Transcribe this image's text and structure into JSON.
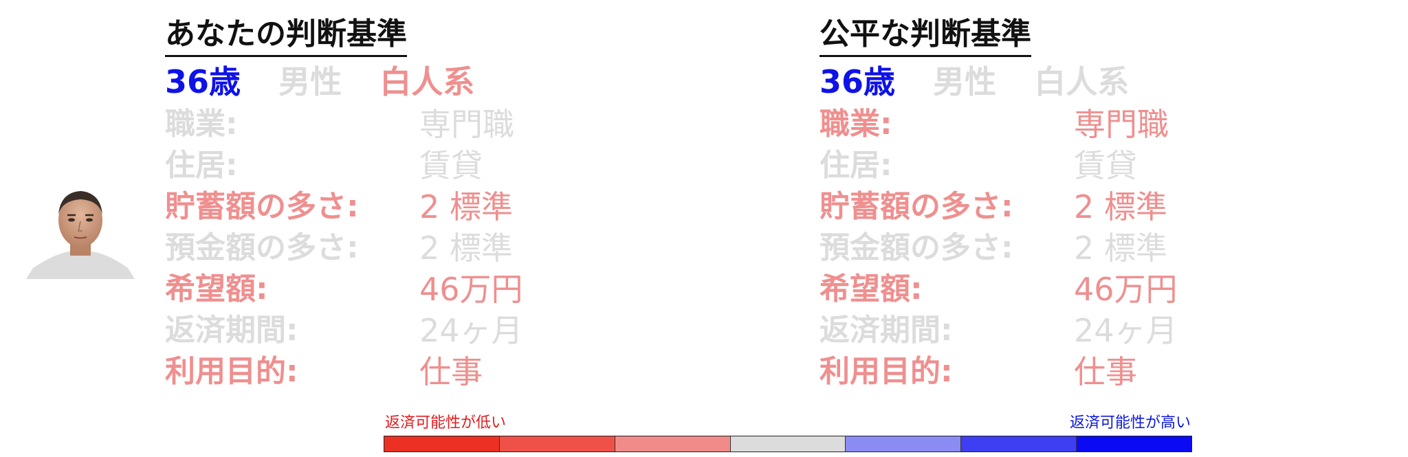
{
  "colors": {
    "age": "#0f12e6",
    "highlight": "#ef8f8f",
    "muted": "#dcdcdc",
    "scale_low_text": "#e31a1c",
    "scale_high_text": "#0b17d8"
  },
  "left_panel": {
    "title": "あなたの判断基準",
    "attributes": [
      {
        "text": "36歳",
        "color": "#0f12e6"
      },
      {
        "text": "男性",
        "color": "#dcdcdc"
      },
      {
        "text": "白人系",
        "color": "#ef8f8f"
      }
    ],
    "fields": [
      {
        "label": "職業:",
        "value": "専門職",
        "color": "#dcdcdc"
      },
      {
        "label": "住居:",
        "value": "賃貸",
        "color": "#dcdcdc"
      },
      {
        "label": "貯蓄額の多さ:",
        "value": "2 標準",
        "color": "#ef8f8f"
      },
      {
        "label": "預金額の多さ:",
        "value": "2 標準",
        "color": "#dcdcdc"
      },
      {
        "label": "希望額:",
        "value": "46万円",
        "color": "#ef8f8f"
      },
      {
        "label": "返済期間:",
        "value": "24ヶ月",
        "color": "#dcdcdc"
      },
      {
        "label": "利用目的:",
        "value": "仕事",
        "color": "#ef8f8f"
      }
    ]
  },
  "right_panel": {
    "title": "公平な判断基準",
    "attributes": [
      {
        "text": "36歳",
        "color": "#0f12e6"
      },
      {
        "text": "男性",
        "color": "#dcdcdc"
      },
      {
        "text": "白人系",
        "color": "#dcdcdc"
      }
    ],
    "fields": [
      {
        "label": "職業:",
        "value": "専門職",
        "color": "#ef8f8f"
      },
      {
        "label": "住居:",
        "value": "賃貸",
        "color": "#dcdcdc"
      },
      {
        "label": "貯蓄額の多さ:",
        "value": "2 標準",
        "color": "#ef8f8f"
      },
      {
        "label": "預金額の多さ:",
        "value": "2 標準",
        "color": "#dcdcdc"
      },
      {
        "label": "希望額:",
        "value": "46万円",
        "color": "#ef8f8f"
      },
      {
        "label": "返済期間:",
        "value": "24ヶ月",
        "color": "#dcdcdc"
      },
      {
        "label": "利用目的:",
        "value": "仕事",
        "color": "#ef8f8f"
      }
    ]
  },
  "scale": {
    "low_label": "返済可能性が低い",
    "high_label": "返済可能性が高い",
    "segments": [
      "#ea3124",
      "#ef5149",
      "#ef8b89",
      "#dcdcdc",
      "#8b8bf4",
      "#3e3ef2",
      "#0a0af4"
    ]
  },
  "face_icon": "person-portrait"
}
